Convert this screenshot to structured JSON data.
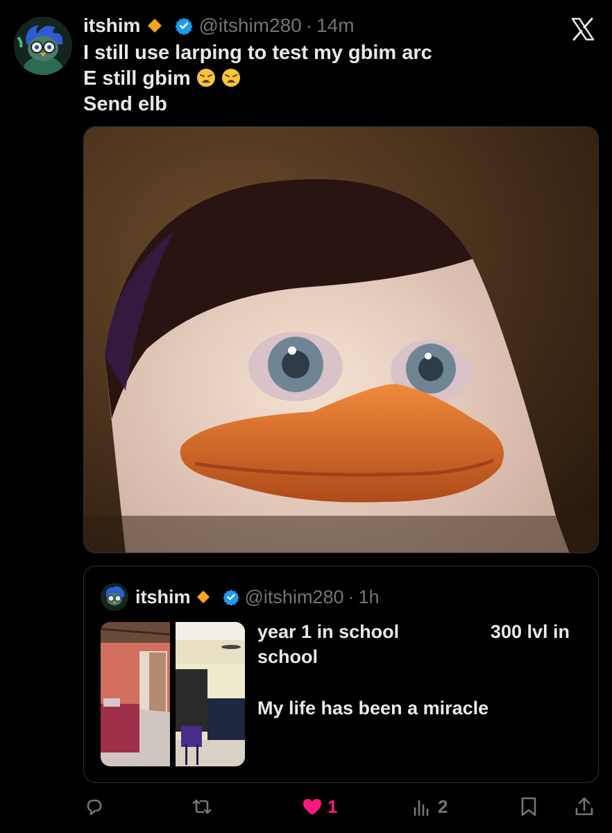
{
  "tweet": {
    "author_name": "itshim",
    "handle": "@itshim280",
    "separator": "·",
    "time": "14m",
    "lines": [
      "I still use larping to test my gbim arc",
      "E still gbim",
      "Send elb"
    ],
    "line2_emojis": [
      "weary-face-emoji",
      "weary-face-emoji"
    ],
    "image": "penguin-closeup-meme"
  },
  "quote": {
    "author_name": "itshim",
    "handle": "@itshim280",
    "separator": "·",
    "time": "1h",
    "text_left": "year 1 in school",
    "text_right": "300 lvl in",
    "text_wrap": "school",
    "text_last": "My life has been a miracle",
    "images": [
      "room-year-1",
      "room-300-lvl"
    ]
  },
  "actions": {
    "reply_count": "",
    "retweet_count": "",
    "like_count": "1",
    "views_count": "2",
    "liked": true
  },
  "colors": {
    "background": "#000000",
    "text": "#e7e9ea",
    "muted": "#71767b",
    "verified": "#1d9bf0",
    "like": "#f91880",
    "border": "#2f3336",
    "diamond": "#f7a51e"
  },
  "icons": [
    "x-logo-icon",
    "verified-badge-icon",
    "diamond-badge-icon",
    "reply-icon",
    "retweet-icon",
    "heart-icon",
    "views-icon",
    "bookmark-icon",
    "share-icon"
  ]
}
